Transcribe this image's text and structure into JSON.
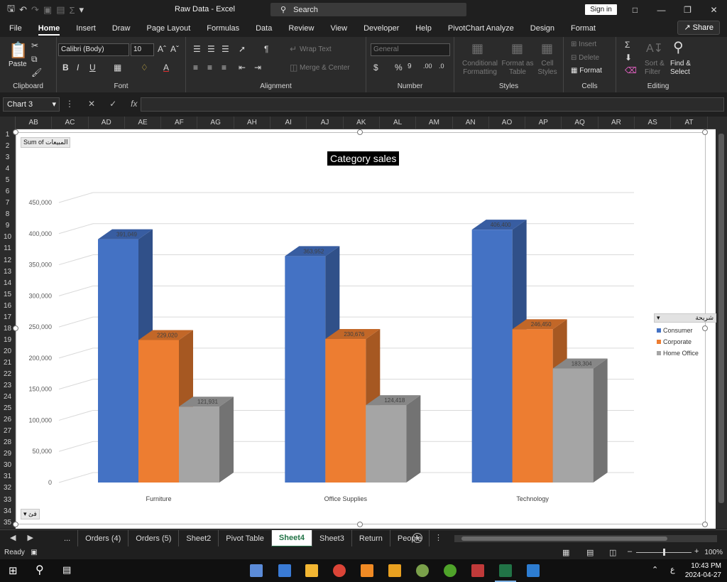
{
  "window": {
    "title": "Raw Data  -  Excel",
    "search_placeholder": "Search",
    "signin_label": "Sign in"
  },
  "ribbon_tabs": [
    "File",
    "Home",
    "Insert",
    "Draw",
    "Page Layout",
    "Formulas",
    "Data",
    "Review",
    "View",
    "Developer",
    "Help",
    "PivotChart Analyze",
    "Design",
    "Format"
  ],
  "active_tab": "Home",
  "share_label": "Share",
  "ribbon": {
    "clipboard": {
      "paste": "Paste",
      "label": "Clipboard"
    },
    "font": {
      "name": "Calibri (Body)",
      "size": "10",
      "label": "Font"
    },
    "alignment": {
      "wrap": "Wrap Text",
      "merge": "Merge & Center",
      "label": "Alignment"
    },
    "number": {
      "format": "General",
      "label": "Number"
    },
    "styles": {
      "conditional": "Conditional Formatting",
      "format_table": "Format as Table",
      "cell_styles": "Cell Styles",
      "label": "Styles"
    },
    "cells": {
      "insert": "Insert",
      "delete": "Delete",
      "format": "Format",
      "label": "Cells"
    },
    "editing": {
      "sort": "Sort & Filter",
      "find": "Find & Select",
      "label": "Editing"
    }
  },
  "formula_bar": {
    "name_box": "Chart 3",
    "fx": "fx"
  },
  "columns": [
    "AB",
    "AC",
    "AD",
    "AE",
    "AF",
    "AG",
    "AH",
    "AI",
    "AJ",
    "AK",
    "AL",
    "AM",
    "AN",
    "AO",
    "AP",
    "AQ",
    "AR",
    "AS",
    "AT"
  ],
  "rows": [
    "1",
    "2",
    "3",
    "4",
    "5",
    "6",
    "7",
    "8",
    "9",
    "10",
    "11",
    "12",
    "13",
    "14",
    "15",
    "16",
    "17",
    "18",
    "19",
    "20",
    "21",
    "22",
    "23",
    "24",
    "25",
    "26",
    "27",
    "28",
    "29",
    "30",
    "31",
    "32",
    "33",
    "34",
    "35"
  ],
  "chart": {
    "value_field_button": "Sum of المبيعات",
    "axis_field_button": "فئ",
    "legend_field_button": "شريحة"
  },
  "chart_data": {
    "type": "bar",
    "title": "Category sales",
    "categories": [
      "Furniture",
      "Office Supplies",
      "Technology"
    ],
    "series": [
      {
        "name": "Consumer",
        "values": [
          391049,
          363952,
          406400
        ],
        "data_labels": [
          "391,049",
          "363,952",
          "406,400"
        ],
        "color": "#4472C4"
      },
      {
        "name": "Corporate",
        "values": [
          229020,
          230676,
          246450
        ],
        "data_labels": [
          "229,020",
          "230,676",
          "246,450"
        ],
        "color": "#ED7D31"
      },
      {
        "name": "Home Office",
        "values": [
          121931,
          124418,
          183304
        ],
        "data_labels": [
          "121,931",
          "124,418",
          "183,304"
        ],
        "color": "#A5A5A5"
      }
    ],
    "ylim": [
      0,
      450000
    ],
    "yticks": [
      "0",
      "50,000",
      "100,000",
      "150,000",
      "200,000",
      "250,000",
      "300,000",
      "350,000",
      "400,000",
      "450,000"
    ],
    "grid": true,
    "legend_position": "right",
    "style": "3d-clustered-column"
  },
  "sheet_tabs": [
    "...",
    "Orders (4)",
    "Orders (5)",
    "Sheet2",
    "Pivot Table",
    "Sheet4",
    "Sheet3",
    "Return",
    "People"
  ],
  "active_sheet": "Sheet4",
  "status": {
    "ready": "Ready",
    "zoom": "100%"
  },
  "clock": {
    "time": "10:43 PM",
    "date": "2024-04-27"
  }
}
